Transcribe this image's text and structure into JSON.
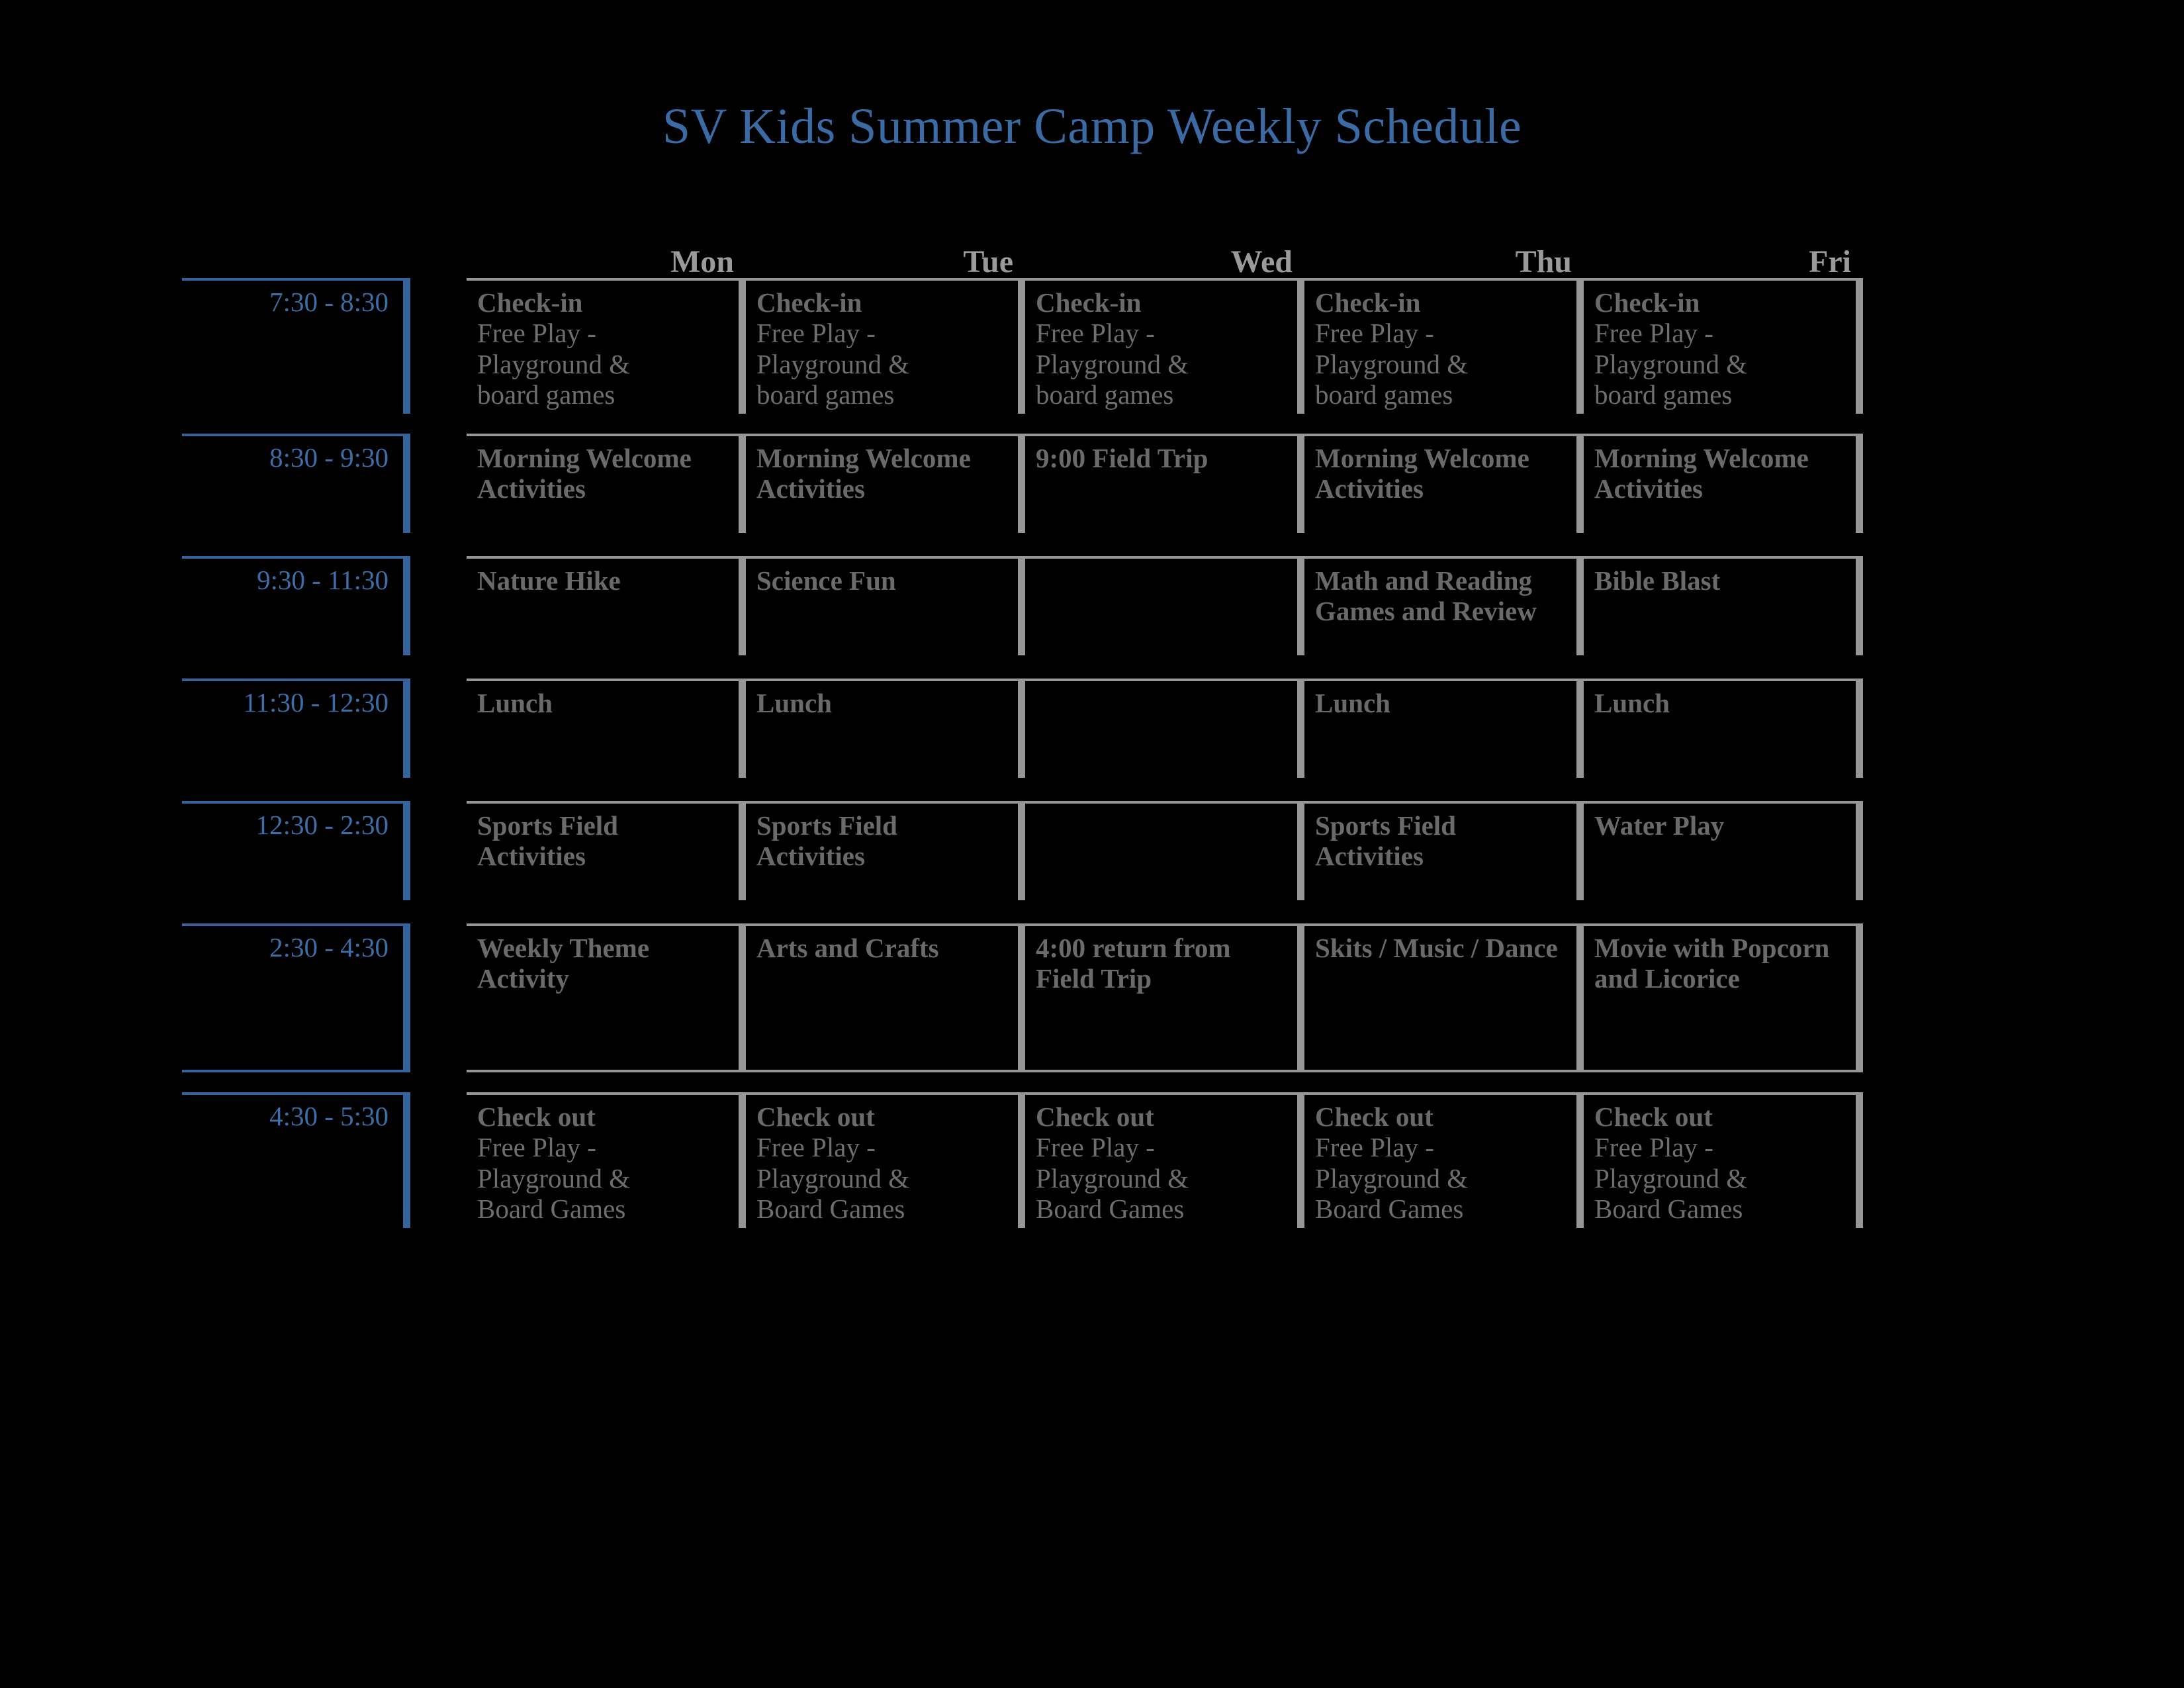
{
  "title": "SV Kids Summer Camp Weekly Schedule",
  "colors": {
    "background": "#000000",
    "title_blue": "#3a6ba5",
    "time_blue": "#35639c",
    "cell_gray": "#969696",
    "text_gray": "#6a6a6a"
  },
  "days": [
    "Mon",
    "Tue",
    "Wed",
    "Thu",
    "Fri"
  ],
  "times": [
    "7:30 - 8:30",
    "8:30 - 9:30",
    "9:30 - 11:30",
    "11:30 - 12:30",
    "12:30 - 2:30",
    "2:30 - 4:30",
    "4:30 - 5:30"
  ],
  "rows": [
    {
      "time": "7:30 - 8:30",
      "cells": [
        {
          "heading": "Check-in",
          "lines": [
            "Free Play -",
            "Playground &",
            "board games"
          ]
        },
        {
          "heading": "Check-in",
          "lines": [
            "Free Play -",
            "Playground &",
            "board games"
          ]
        },
        {
          "heading": "Check-in",
          "lines": [
            "Free Play -",
            "Playground &",
            "board games"
          ]
        },
        {
          "heading": "Check-in",
          "lines": [
            "Free Play -",
            "Playground &",
            "board games"
          ]
        },
        {
          "heading": "Check-in",
          "lines": [
            "Free Play -",
            "Playground &",
            "board games"
          ]
        }
      ]
    },
    {
      "time": "8:30 - 9:30",
      "cells": [
        {
          "heading": "Morning Welcome Activities",
          "lines": []
        },
        {
          "heading": "Morning Welcome Activities",
          "lines": []
        },
        {
          "heading": "9:00 Field Trip",
          "lines": []
        },
        {
          "heading": "Morning Welcome Activities",
          "lines": []
        },
        {
          "heading": "Morning Welcome Activities",
          "lines": []
        }
      ]
    },
    {
      "time": "9:30 - 11:30",
      "cells": [
        {
          "heading": "Nature Hike",
          "lines": []
        },
        {
          "heading": "Science Fun",
          "lines": []
        },
        {
          "heading": "",
          "lines": []
        },
        {
          "heading": "Math and Reading Games and Review",
          "lines": []
        },
        {
          "heading": "Bible Blast",
          "lines": []
        }
      ]
    },
    {
      "time": "11:30 - 12:30",
      "cells": [
        {
          "heading": "Lunch",
          "lines": []
        },
        {
          "heading": "Lunch",
          "lines": []
        },
        {
          "heading": "",
          "lines": []
        },
        {
          "heading": "Lunch",
          "lines": []
        },
        {
          "heading": "Lunch",
          "lines": []
        }
      ]
    },
    {
      "time": "12:30 - 2:30",
      "cells": [
        {
          "heading": "Sports Field Activities",
          "lines": []
        },
        {
          "heading": "Sports Field Activities",
          "lines": []
        },
        {
          "heading": "",
          "lines": []
        },
        {
          "heading": "Sports Field Activities",
          "lines": []
        },
        {
          "heading": "Water Play",
          "lines": []
        }
      ]
    },
    {
      "time": "2:30 - 4:30",
      "cells": [
        {
          "heading": "Weekly Theme Activity",
          "lines": []
        },
        {
          "heading": "Arts and Crafts",
          "lines": []
        },
        {
          "heading": "4:00 return from Field Trip",
          "lines": []
        },
        {
          "heading": "Skits / Music / Dance",
          "lines": []
        },
        {
          "heading": "Movie with Popcorn and Licorice",
          "lines": []
        }
      ]
    },
    {
      "time": "4:30 - 5:30",
      "cells": [
        {
          "heading": "Check out",
          "lines": [
            "Free Play -",
            "Playground &",
            "Board Games"
          ]
        },
        {
          "heading": "Check out",
          "lines": [
            "Free Play -",
            "Playground &",
            "Board Games"
          ]
        },
        {
          "heading": "Check out",
          "lines": [
            "Free Play -",
            "Playground &",
            "Board Games"
          ]
        },
        {
          "heading": "Check out",
          "lines": [
            "Free Play -",
            "Playground &",
            "Board Games"
          ]
        },
        {
          "heading": "Check out",
          "lines": [
            "Free Play -",
            "Playground &",
            "Board Games"
          ]
        }
      ]
    }
  ]
}
